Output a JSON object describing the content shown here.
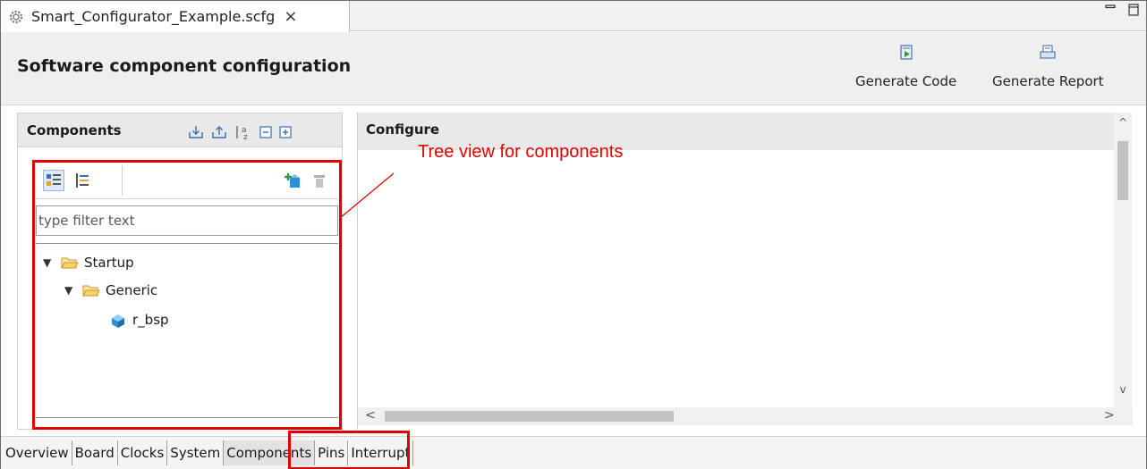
{
  "editor_tab": {
    "title": "Smart_Configurator_Example.scfg",
    "close_glyph": "×"
  },
  "window_controls": {
    "minimize_icon": "minimize-icon",
    "maximize_icon": "maximize-icon"
  },
  "header": {
    "title": "Software component configuration",
    "generate_code_label": "Generate Code",
    "generate_report_label": "Generate Report"
  },
  "components_panel": {
    "title": "Components",
    "filter_placeholder": "type filter text",
    "tree": [
      {
        "label": "Startup",
        "level": 0,
        "expanded": true,
        "icon": "folder-open-icon"
      },
      {
        "label": "Generic",
        "level": 1,
        "expanded": true,
        "icon": "folder-open-icon"
      },
      {
        "label": "r_bsp",
        "level": 2,
        "expanded": false,
        "icon": "component-icon"
      }
    ]
  },
  "configure_panel": {
    "title": "Configure"
  },
  "bottom_tabs": [
    {
      "label": "Overview",
      "active": false
    },
    {
      "label": "Board",
      "active": false
    },
    {
      "label": "Clocks",
      "active": false
    },
    {
      "label": "System",
      "active": false
    },
    {
      "label": "Components",
      "active": true
    },
    {
      "label": "Pins",
      "active": false
    },
    {
      "label": "Interrupt",
      "active": false
    }
  ],
  "annotation": {
    "label": "Tree view for components",
    "color": "#e00000"
  },
  "colors": {
    "header_bg": "#efefef",
    "panel_head_bg": "#e9e9e9",
    "annotation": "#e00000"
  }
}
